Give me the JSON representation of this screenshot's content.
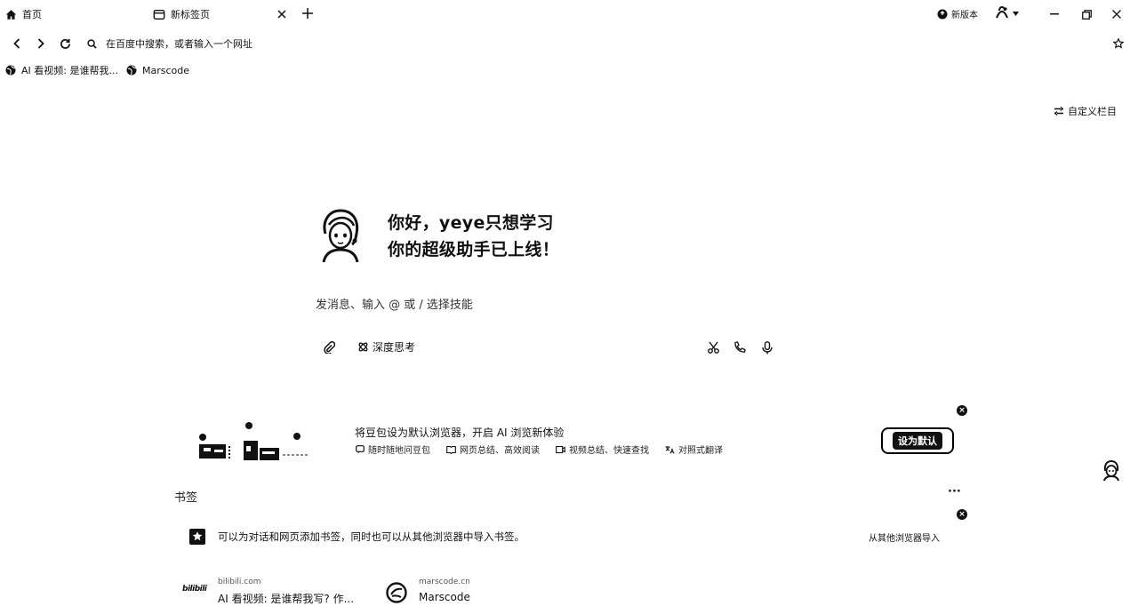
{
  "tabs": [
    {
      "label": "首页",
      "icon": "home-icon"
    },
    {
      "label": "新标签页",
      "icon": "tab-page-icon"
    }
  ],
  "window": {
    "new_version_label": "新版本"
  },
  "address_bar": {
    "placeholder": "在百度中搜索，或者输入一个网址"
  },
  "bookmarks_bar": [
    {
      "label": "AI 看视频: 是谁帮我...",
      "icon": "globe-icon"
    },
    {
      "label": "Marscode",
      "icon": "globe-icon"
    }
  ],
  "customize_label": "自定义栏目",
  "greeting": {
    "line1": "你好，yeye只想学习",
    "line2": "你的超级助手已上线！"
  },
  "chat_input": {
    "placeholder": "发消息、输入 @ 或 / 选择技能"
  },
  "toolbar": {
    "deep_think_label": "深度思考"
  },
  "promo": {
    "title": "将豆包设为默认浏览器，开启 AI 浏览新体验",
    "features": [
      {
        "label": "随时随地问豆包",
        "icon": "chat-icon"
      },
      {
        "label": "网页总结、高效阅读",
        "icon": "book-icon"
      },
      {
        "label": "视频总结、快速查找",
        "icon": "video-icon"
      },
      {
        "label": "对照式翻译",
        "icon": "translate-icon"
      }
    ],
    "button_label": "设为默认"
  },
  "bookmarks_section": {
    "title": "书签",
    "more_label": "···",
    "hint": "可以为对话和网页添加书签，同时也可以从其他浏览器中导入书签。",
    "import_label": "从其他浏览器导入",
    "cards": [
      {
        "domain": "bilibili.com",
        "title": "AI 看视频: 是谁帮我写? 作...",
        "logo_text": "bilibili"
      },
      {
        "domain": "marscode.cn",
        "title": "Marscode"
      }
    ]
  }
}
